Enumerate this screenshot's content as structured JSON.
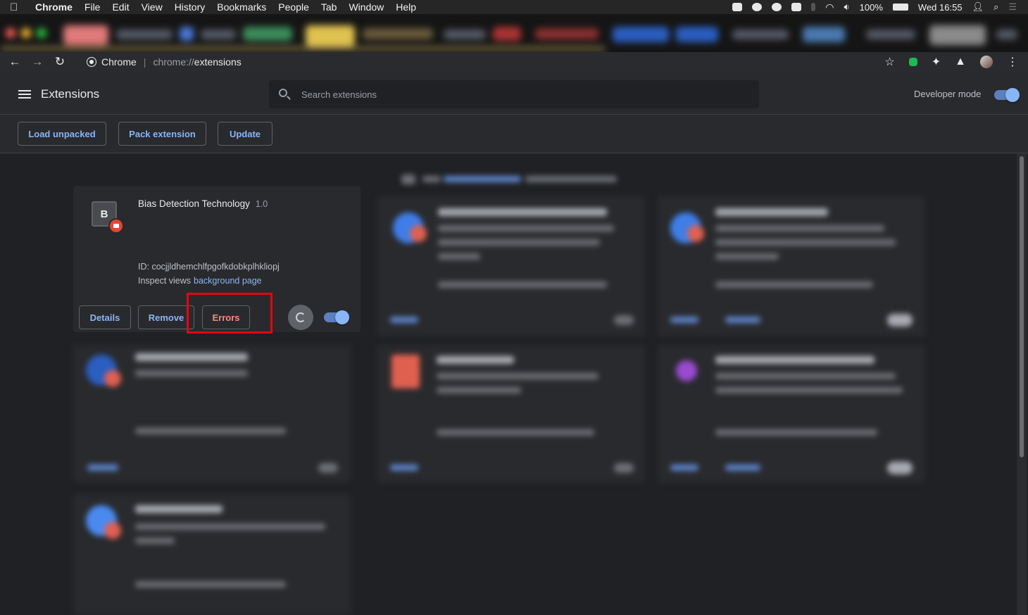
{
  "menubar": {
    "items": [
      "Chrome",
      "File",
      "Edit",
      "View",
      "History",
      "Bookmarks",
      "People",
      "Tab",
      "Window",
      "Help"
    ],
    "battery": "100%",
    "clock": "Wed 16:55"
  },
  "address_bar": {
    "site_chip": "Chrome",
    "url_scheme": "chrome://",
    "url_path": "extensions"
  },
  "header": {
    "title": "Extensions",
    "search_placeholder": "Search extensions",
    "developer_mode_label": "Developer mode",
    "developer_mode_on": true
  },
  "dev_toolbar": {
    "load_unpacked": "Load unpacked",
    "pack_extension": "Pack extension",
    "update": "Update"
  },
  "focused_extension": {
    "icon_letter": "B",
    "name": "Bias Detection Technology",
    "version": "1.0",
    "id_text": "ID: cocjjldhemchlfpgofkdobkplhkliopj",
    "inspect_label": "Inspect views",
    "inspect_link": "background page",
    "details_button": "Details",
    "remove_button": "Remove",
    "errors_button": "Errors",
    "enabled": true
  },
  "colors": {
    "accent": "#8ab4f8",
    "error": "#f28b82",
    "highlight_box": "#e30613",
    "background": "#202124",
    "card": "#292a2d"
  }
}
